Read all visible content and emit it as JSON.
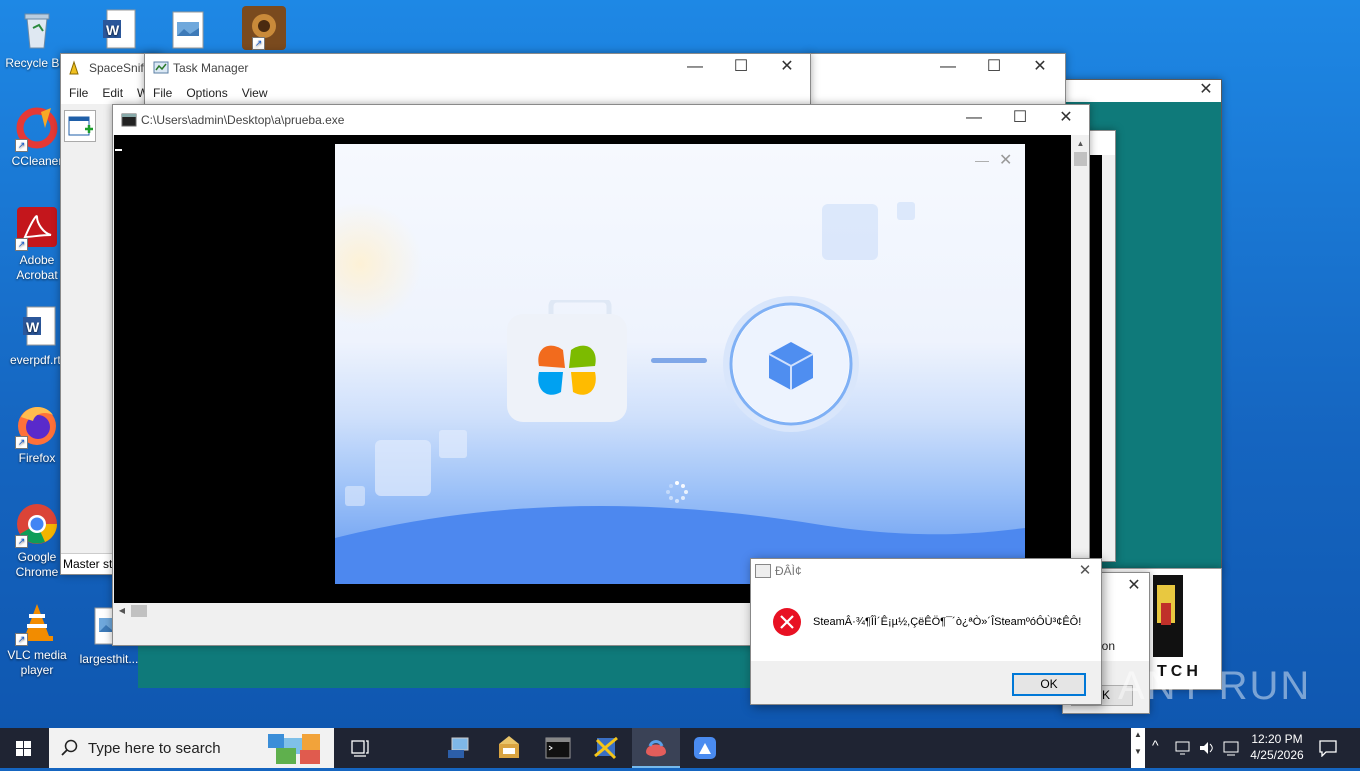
{
  "desktop": {
    "icons": [
      {
        "label": "Recycle Bin"
      },
      {
        "label": "CCleaner"
      },
      {
        "label": "Adobe Acrobat"
      },
      {
        "label": "everpdf.rtf"
      },
      {
        "label": "Firefox"
      },
      {
        "label": "Google Chrome"
      },
      {
        "label": "VLC media player"
      },
      {
        "label": "largesthit..."
      }
    ]
  },
  "spacesniffer": {
    "title": "SpaceSniffer",
    "menu": [
      "File",
      "Edit",
      "W"
    ],
    "status": "Master st"
  },
  "taskmanager": {
    "title": "Task Manager",
    "menu": [
      "File",
      "Options",
      "View"
    ]
  },
  "console": {
    "title": "C:\\Users\\admin\\Desktop\\a\\prueba.exe"
  },
  "background_partial": {
    "text_ion": "ion",
    "text_k": "K",
    "text_tch": "TCH"
  },
  "dialog": {
    "title": "ÐÂÌ¢",
    "message": "SteamÂ·¾¶ÎÌ´Ê¡µ½,ÇëÊÖ¶¯´ò¿ªÒ»´ÎSteamºóÔÙ³¢ÊÔ!",
    "ok_label": "OK"
  },
  "watermark": "ANY RUN",
  "taskbar": {
    "search_placeholder": "Type here to search",
    "time": "12:20 PM",
    "date": "4/25/2026"
  },
  "colors": {
    "desktop_blue": "#1565c0",
    "taskbar": "#1f2433",
    "accent": "#0078d7",
    "error_red": "#e81123",
    "teal": "#0f7a7a"
  }
}
